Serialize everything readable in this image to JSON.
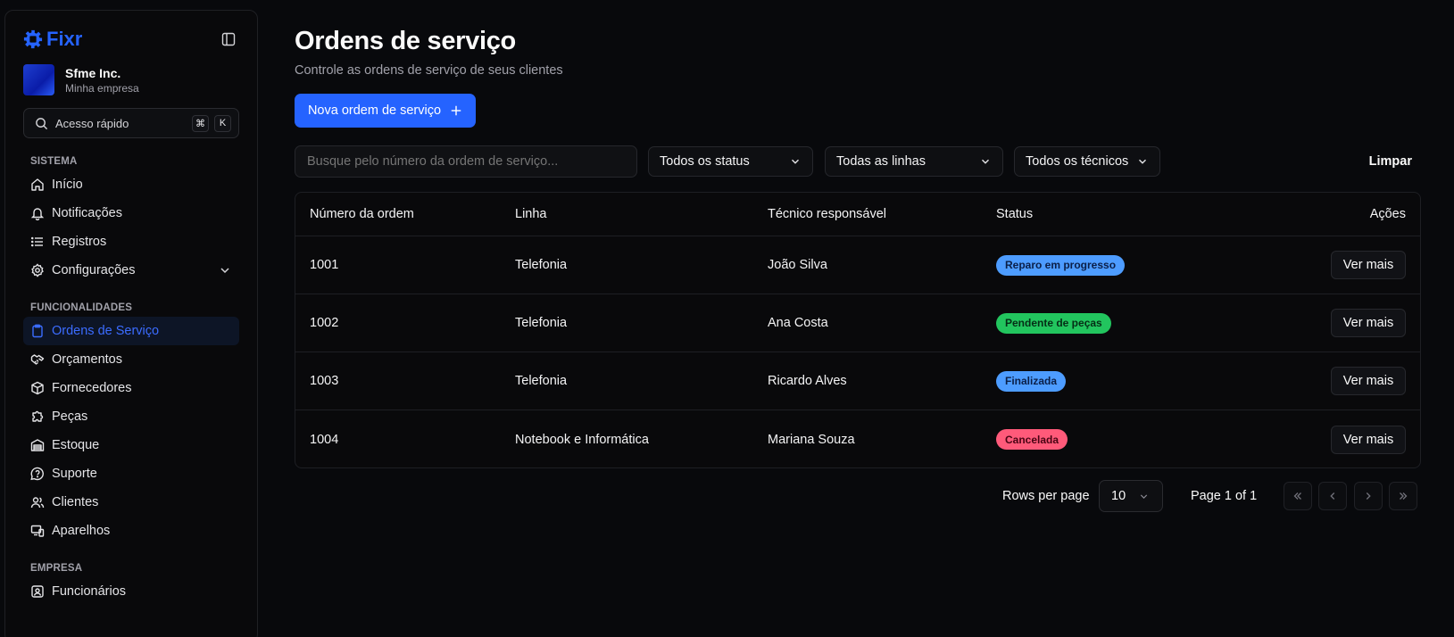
{
  "sidebar": {
    "brand": "Fixr",
    "company": {
      "name": "Sfme Inc.",
      "subtitle": "Minha empresa"
    },
    "quick_access": {
      "label": "Acesso rápido",
      "keys": [
        "⌘",
        "K"
      ]
    },
    "sections": [
      {
        "title": "Sistema",
        "items": [
          {
            "label": "Início",
            "icon": "home-icon"
          },
          {
            "label": "Notificações",
            "icon": "bell-icon"
          },
          {
            "label": "Registros",
            "icon": "list-icon"
          },
          {
            "label": "Configurações",
            "icon": "gear-icon",
            "expandable": true
          }
        ]
      },
      {
        "title": "Funcionalidades",
        "items": [
          {
            "label": "Ordens de Serviço",
            "icon": "clipboard-icon",
            "active": true
          },
          {
            "label": "Orçamentos",
            "icon": "handshake-icon"
          },
          {
            "label": "Fornecedores",
            "icon": "box-icon"
          },
          {
            "label": "Peças",
            "icon": "puzzle-icon"
          },
          {
            "label": "Estoque",
            "icon": "warehouse-icon"
          },
          {
            "label": "Suporte",
            "icon": "help-circle-icon"
          },
          {
            "label": "Clientes",
            "icon": "users-icon"
          },
          {
            "label": "Aparelhos",
            "icon": "devices-icon"
          }
        ]
      },
      {
        "title": "Empresa",
        "items": [
          {
            "label": "Funcionários",
            "icon": "contact-icon"
          }
        ]
      }
    ]
  },
  "header": {
    "title": "Ordens de serviço",
    "subtitle": "Controle as ordens de serviço de seus clientes",
    "new_button": "Nova ordem de serviço"
  },
  "filters": {
    "search_placeholder": "Busque pelo número da ordem de serviço...",
    "status": "Todos os status",
    "line": "Todas as linhas",
    "technician": "Todos os técnicos",
    "clear": "Limpar"
  },
  "table": {
    "columns": [
      "Número da ordem",
      "Linha",
      "Técnico responsável",
      "Status",
      "Ações"
    ],
    "rows": [
      {
        "number": "1001",
        "line": "Telefonia",
        "technician": "João Silva",
        "status": "Reparo em progresso",
        "action": "Ver mais"
      },
      {
        "number": "1002",
        "line": "Telefonia",
        "technician": "Ana Costa",
        "status": "Pendente de peças",
        "action": "Ver mais"
      },
      {
        "number": "1003",
        "line": "Telefonia",
        "technician": "Ricardo Alves",
        "status": "Finalizada",
        "action": "Ver mais"
      },
      {
        "number": "1004",
        "line": "Notebook e Informática",
        "technician": "Mariana Souza",
        "status": "Cancelada",
        "action": "Ver mais"
      }
    ]
  },
  "status_colors": {
    "Reparo em progresso": {
      "bg": "#4d9cff",
      "fg": "#0b1f47"
    },
    "Pendente de peças": {
      "bg": "#22c55e",
      "fg": "#052e16"
    },
    "Finalizada": {
      "bg": "#4d9cff",
      "fg": "#0b1f47"
    },
    "Cancelada": {
      "bg": "#ff5a7a",
      "fg": "#4a0414"
    }
  },
  "pagination": {
    "rows_per_page_label": "Rows per page",
    "rows_per_page": "10",
    "page_label": "Page 1 of 1"
  },
  "colors": {
    "accent": "#2563ff",
    "background": "#08090c"
  }
}
